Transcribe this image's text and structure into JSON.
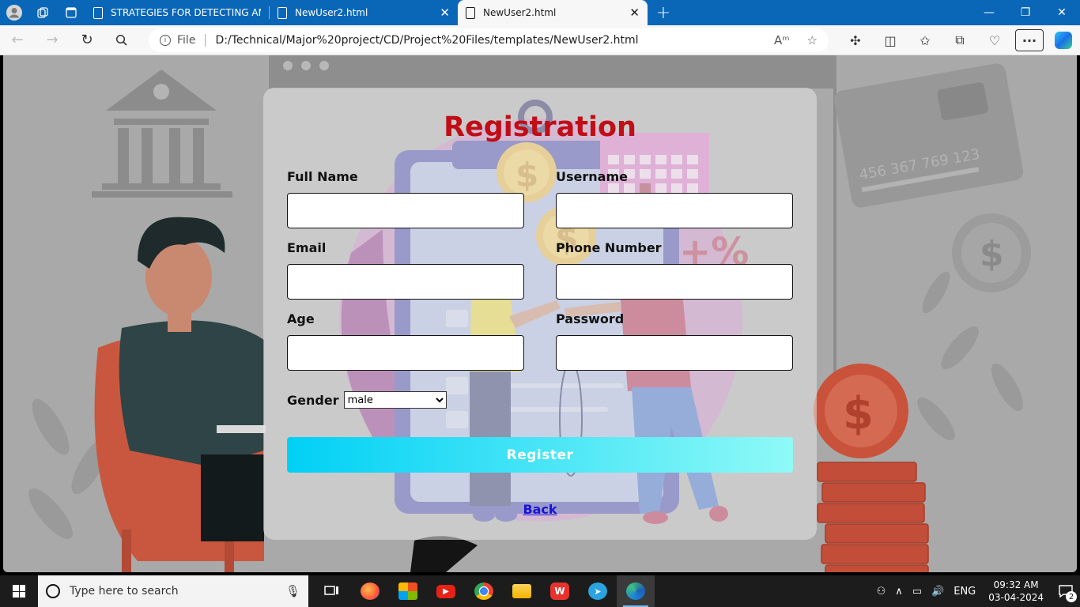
{
  "browser": {
    "tabs": [
      {
        "title": "STRATEGIES FOR DETECTING AN",
        "active": false
      },
      {
        "title": "NewUser2.html",
        "active": false
      },
      {
        "title": "NewUser2.html",
        "active": true
      }
    ],
    "address": {
      "scheme_label": "File",
      "url": "D:/Technical/Major%20project/CD/Project%20Files/templates/NewUser2.html"
    }
  },
  "page": {
    "title": "Registration",
    "fields": [
      {
        "label": "Full Name",
        "value": ""
      },
      {
        "label": "Username",
        "value": ""
      },
      {
        "label": "Email",
        "value": ""
      },
      {
        "label": "Phone Number",
        "value": ""
      },
      {
        "label": "Age",
        "value": ""
      },
      {
        "label": "Password",
        "value": ""
      }
    ],
    "gender": {
      "label": "Gender",
      "selected": "male"
    },
    "register_label": "Register",
    "back_label": "Back",
    "colors": {
      "title": "#c00d16",
      "button_start": "#00d0f5",
      "button_end": "#8ffaf7",
      "link": "#1a12d6"
    },
    "background": {
      "card_number": "456 367 769 123"
    }
  },
  "taskbar": {
    "search_placeholder": "Type here to search",
    "language": "ENG",
    "time": "09:32 AM",
    "date": "03-04-2024",
    "notification_count": "2"
  }
}
